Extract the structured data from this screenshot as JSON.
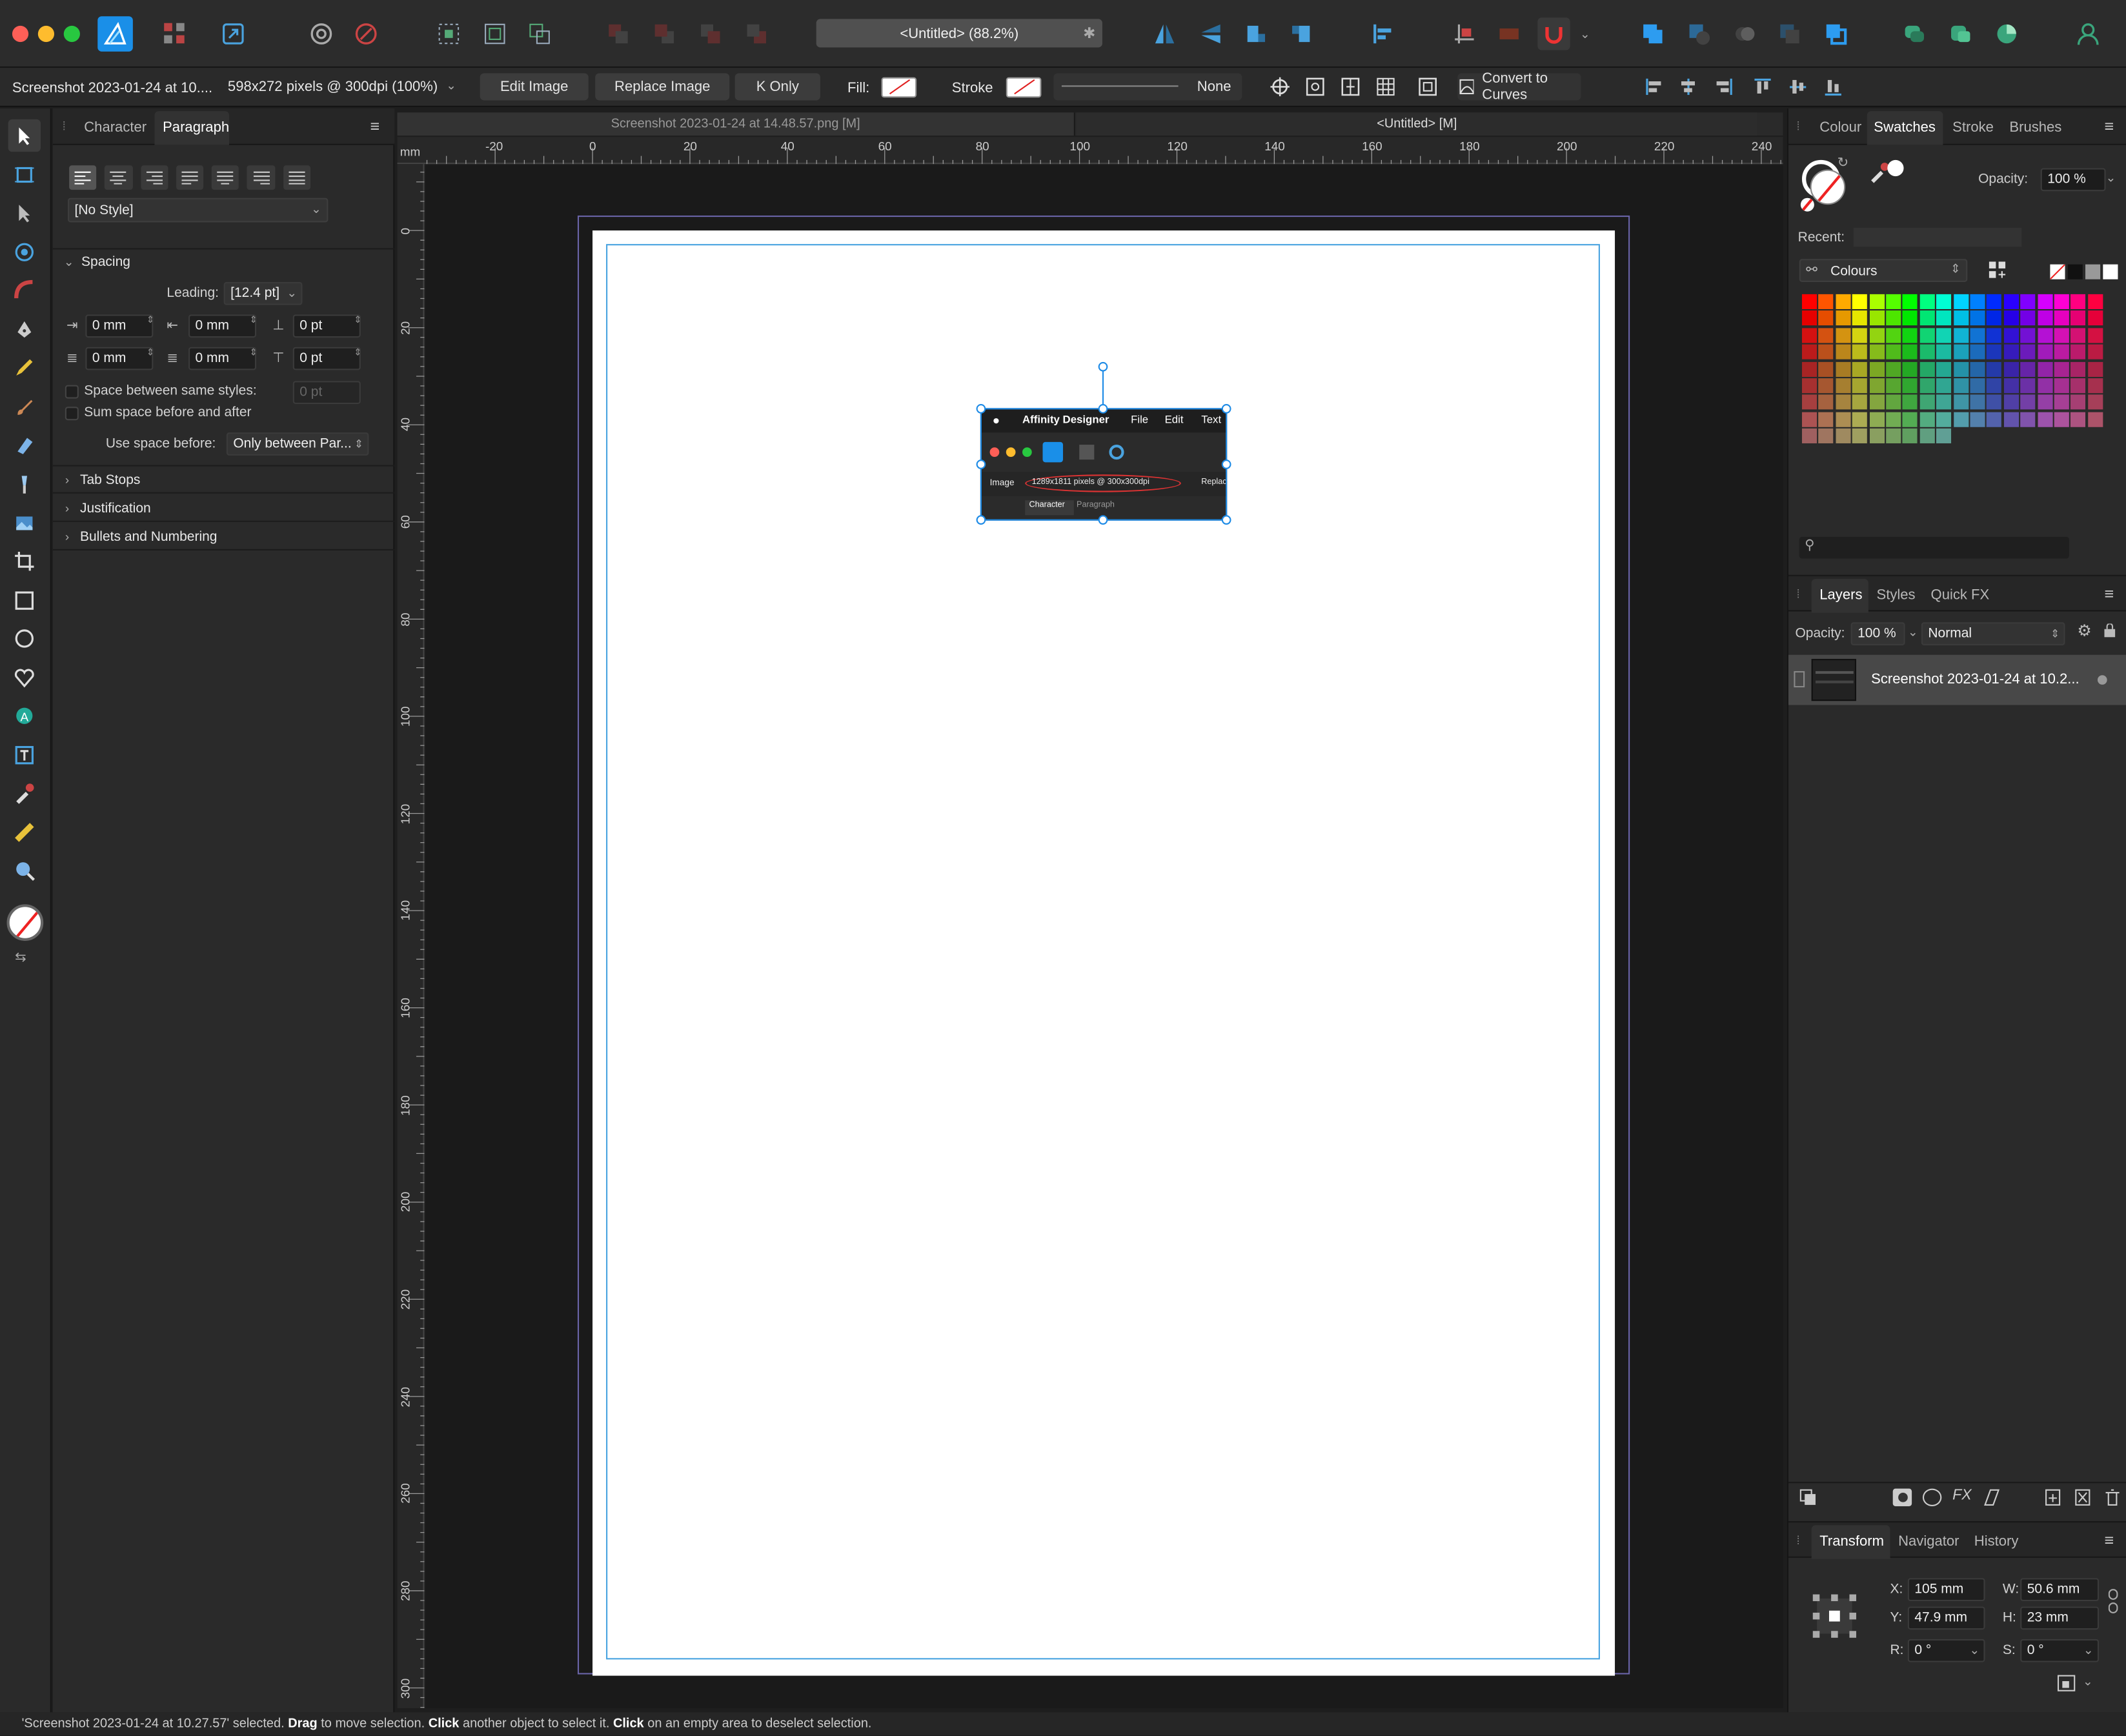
{
  "toolbar": {
    "doc_title": "<Untitled> (88.2%)",
    "accent": "#2d9cf0"
  },
  "context": {
    "layer_name": "Screenshot 2023-01-24 at 10....",
    "image_info": "598x272 pixels @ 300dpi (100%)",
    "edit_image": "Edit Image",
    "replace_image": "Replace Image",
    "k_only": "K Only",
    "fill_label": "Fill:",
    "stroke_label": "Stroke",
    "stroke_value": "None",
    "convert_to_curves": "Convert to Curves"
  },
  "left_panel": {
    "tabs": [
      "Character",
      "Paragraph"
    ],
    "style_select": "[No Style]",
    "spacing_heading": "Spacing",
    "leading_label": "Leading:",
    "leading_value": "[12.4 pt]",
    "fields": [
      "0 mm",
      "0 mm",
      "0 pt",
      "0 mm",
      "0 mm",
      "0 pt"
    ],
    "space_between": "Space between same styles:",
    "space_between_value": "0 pt",
    "sum_space": "Sum space before and after",
    "use_space_label": "Use space before:",
    "use_space_value": "Only between Par...",
    "sections": [
      "Tab Stops",
      "Justification",
      "Bullets and Numbering"
    ]
  },
  "doc_tabs": [
    "Screenshot 2023-01-24 at 14.48.57.png [M]",
    "<Untitled> [M]"
  ],
  "ruler": {
    "unit": "mm",
    "h_labels": [
      "-20",
      "0",
      "20",
      "40",
      "60",
      "80",
      "100",
      "120",
      "140",
      "160",
      "180",
      "200",
      "220",
      "240"
    ],
    "v_labels": [
      "0",
      "20",
      "40",
      "60",
      "80",
      "100",
      "120",
      "140",
      "160",
      "180",
      "200",
      "220",
      "240",
      "260",
      "280",
      "300"
    ]
  },
  "embedded_shot": {
    "app": "Affinity Designer",
    "menus": [
      "File",
      "Edit",
      "Text"
    ],
    "image_label": "Image",
    "pixels": "1289x1811 pixels @ 300x300dpi",
    "replace": "Replac",
    "tabs": [
      "Character",
      "Paragraph"
    ]
  },
  "right_panel": {
    "top_tabs": [
      "Colour",
      "Swatches",
      "Stroke",
      "Brushes"
    ],
    "opacity_label": "Opacity:",
    "opacity_value": "100 %",
    "recent_label": "Recent:",
    "palette_name": "Colours",
    "layers_tabs": [
      "Layers",
      "Styles",
      "Quick FX"
    ],
    "layers_opacity_label": "Opacity:",
    "layers_opacity": "100 %",
    "blend_mode": "Normal",
    "layer_item": "Screenshot 2023-01-24 at 10.2...",
    "transform_tabs": [
      "Transform",
      "Navigator",
      "History"
    ],
    "x_label": "X:",
    "x_value": "105 mm",
    "y_label": "Y:",
    "y_value": "47.9 mm",
    "w_label": "W:",
    "w_value": "50.6 mm",
    "h_label": "H:",
    "h_value": "23 mm",
    "r_label": "R:",
    "r_value": "0 °",
    "s_label": "S:",
    "s_value": "0 °"
  },
  "status": {
    "selected": "'Screenshot 2023-01-24 at 10.27.57' selected.",
    "drag": "Drag",
    "drag_text": "to move selection.",
    "click1": "Click",
    "click1_text": "another object to select it.",
    "click2": "Click",
    "click2_text": "on an empty area to deselect selection."
  }
}
